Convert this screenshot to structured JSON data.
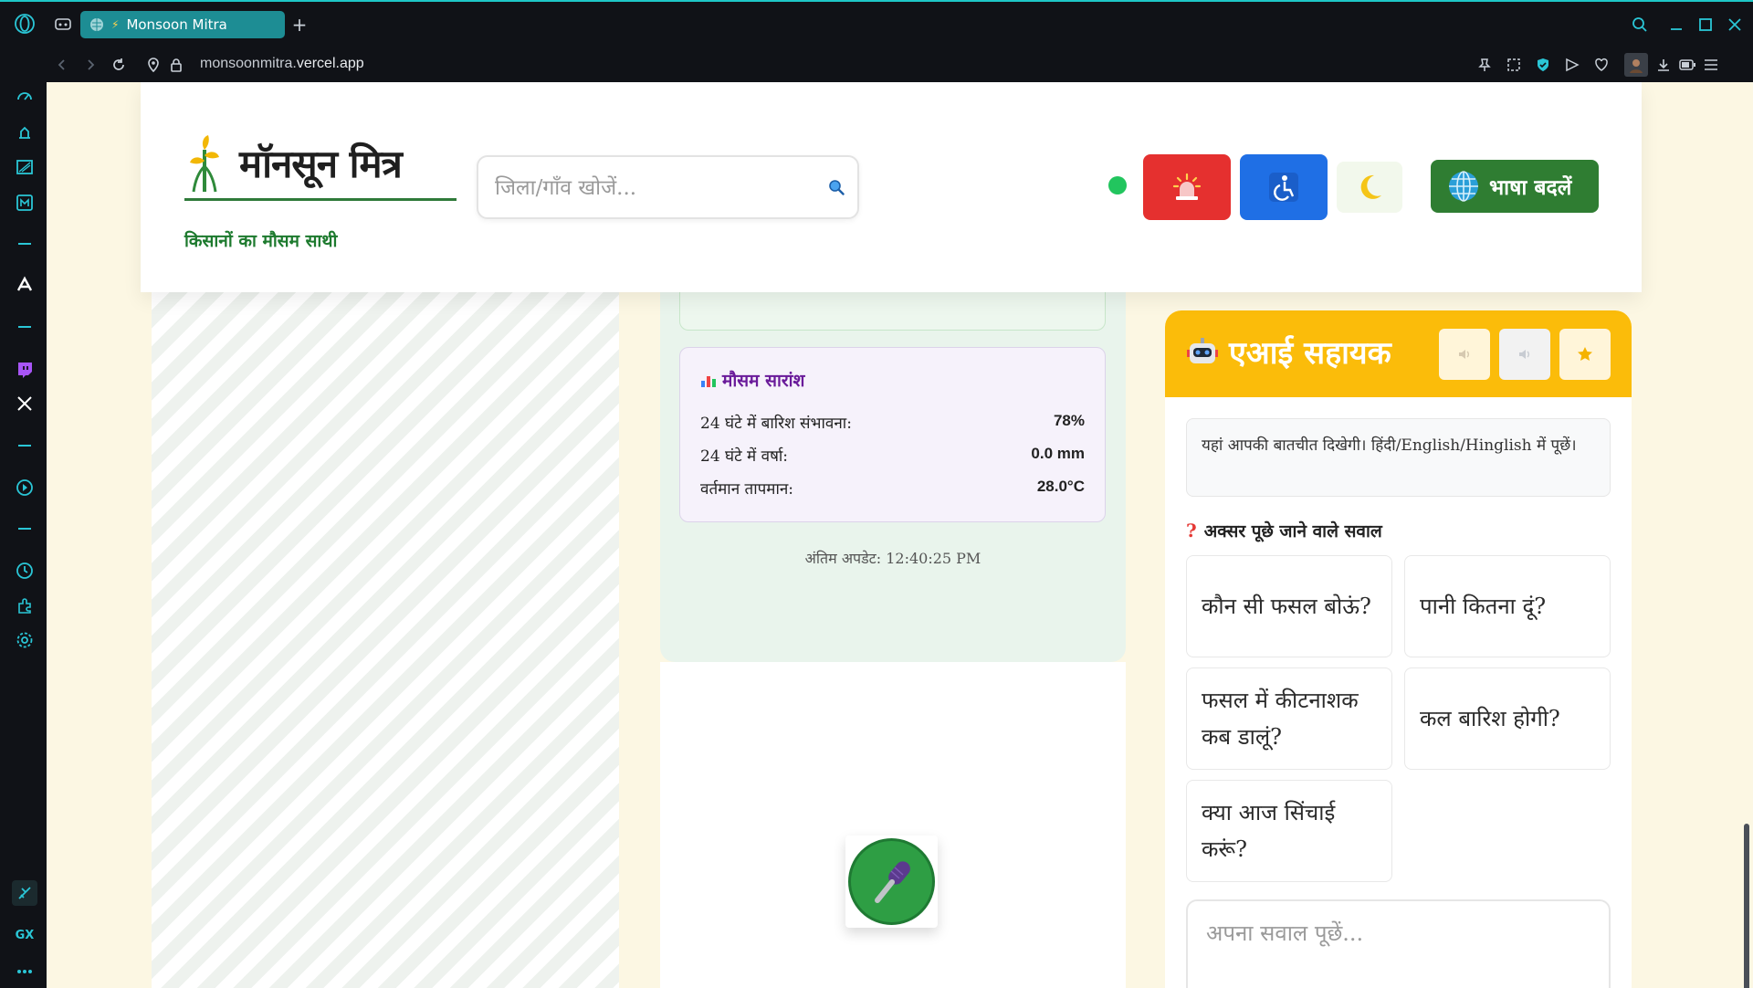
{
  "browser": {
    "tab_title": "Monsoon Mitra",
    "url_prefix": "monsoonmitra.",
    "url_domain": "vercel.app",
    "accent": "#1ec7c7",
    "sidebar_label_gx": "GX"
  },
  "header": {
    "app_name": "मॉनसून मित्र",
    "tagline": "किसानों का मौसम साथी",
    "search_placeholder": "जिला/गाँव खोजें...",
    "status_color": "#22c55e",
    "language_button": "भाषा बदलें",
    "emergency_color": "#e5302f",
    "accessibility_color": "#1f6fe5"
  },
  "weather": {
    "summary_title": "मौसम सारांश",
    "rows": [
      {
        "label": "24 घंटे में बारिश संभावना:",
        "value": "78%"
      },
      {
        "label": "24 घंटे में वर्षा:",
        "value": "0.0 mm"
      },
      {
        "label": "वर्तमान तापमान:",
        "value": "28.0°C"
      }
    ],
    "last_update": "अंतिम अपडेट: 12:40:25 PM"
  },
  "assistant": {
    "title": "एआई सहायक",
    "accent": "#fbbc0a",
    "chat_placeholder": "यहां आपकी बातचीत दिखेगी। हिंदी/English/Hinglish में पूछें।",
    "faq_title": "अक्सर पूछे जाने वाले सवाल",
    "faqs": [
      "कौन सी फसल बोऊं?",
      "पानी कितना दूं?",
      "फसल में कीटनाशक कब डालूं?",
      "कल बारिश होगी?",
      "क्या आज सिंचाई करूं?"
    ],
    "input_placeholder": "अपना सवाल पूछें..."
  }
}
